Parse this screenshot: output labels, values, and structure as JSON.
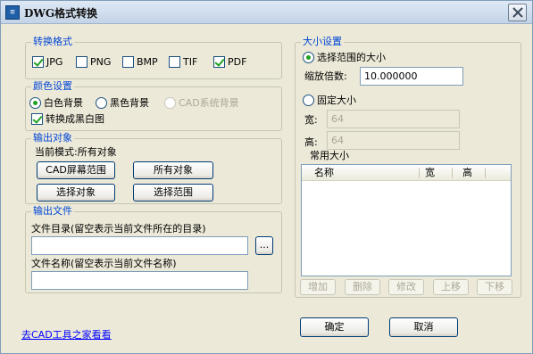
{
  "window": {
    "title": "DWG格式转换",
    "app_icon": "dwg-app-icon",
    "close_icon": "close-icon"
  },
  "format_group": {
    "title": "转换格式",
    "options": [
      {
        "label": "JPG",
        "checked": true
      },
      {
        "label": "PNG",
        "checked": false
      },
      {
        "label": "BMP",
        "checked": false
      },
      {
        "label": "TIF",
        "checked": false
      },
      {
        "label": "PDF",
        "checked": true
      }
    ]
  },
  "color_group": {
    "title": "颜色设置",
    "white_bg": "白色背景",
    "black_bg": "黑色背景",
    "cad_bg": "CAD系统背景",
    "bw_label": "转换成黑白图"
  },
  "output_objects": {
    "title": "输出对象",
    "current_mode": "当前模式:所有对象",
    "cad_screen_range": "CAD屏幕范围",
    "all_objects": "所有对象",
    "select_objects": "选择对象",
    "select_range": "选择范围"
  },
  "output_file": {
    "title": "输出文件",
    "dir_label": "文件目录(留空表示当前文件所在的目录)",
    "dir_value": "",
    "browse": "...",
    "name_label": "文件名称(留空表示当前文件名称)",
    "name_value": ""
  },
  "size_group": {
    "title": "大小设置",
    "range_size": "选择范围的大小",
    "scale_label": "缩放倍数:",
    "scale_value": "10.000000",
    "fixed_size": "固定大小",
    "width_label": "宽:",
    "width_value": "64",
    "height_label": "高:",
    "height_value": "64",
    "common_label": "常用大小",
    "columns": [
      "名称",
      "宽",
      "高"
    ],
    "add": "增加",
    "delete": "删除",
    "modify": "修改",
    "move_up": "上移",
    "move_down": "下移"
  },
  "footer": {
    "link": "去CAD工具之家看看",
    "ok": "确定",
    "cancel": "取消"
  }
}
